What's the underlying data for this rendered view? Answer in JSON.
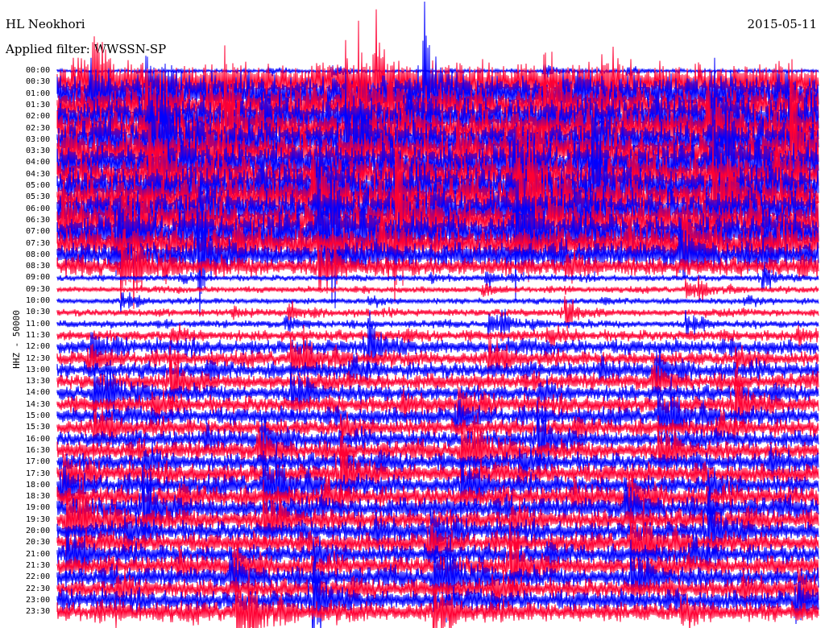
{
  "header": {
    "station": "HL Neokhori",
    "date": "2015-05-11",
    "filter": "Applied filter: WWSSN-SP"
  },
  "chart_data": {
    "type": "line",
    "title": "HL Neokhori",
    "subtitle": "Applied filter: WWSSN-SP",
    "date": "2015-05-11",
    "ylabel": "HHZ - 50000",
    "row_labels": [
      "00:00",
      "00:30",
      "01:00",
      "01:30",
      "02:00",
      "02:30",
      "03:00",
      "03:30",
      "04:00",
      "04:30",
      "05:00",
      "05:30",
      "06:00",
      "06:30",
      "07:00",
      "07:30",
      "08:00",
      "08:30",
      "09:00",
      "09:30",
      "10:00",
      "10:30",
      "11:00",
      "11:30",
      "12:00",
      "12:30",
      "13:00",
      "13:30",
      "14:00",
      "14:30",
      "15:00",
      "15:30",
      "16:00",
      "16:30",
      "17:00",
      "17:30",
      "18:00",
      "18:30",
      "19:00",
      "19:30",
      "20:00",
      "20:30",
      "21:00",
      "21:30",
      "22:00",
      "22:30",
      "23:00",
      "23:30"
    ],
    "row_colors": [
      "#0000ff",
      "#ff0033"
    ],
    "relative_activity": [
      0.3,
      3,
      3,
      3,
      3,
      3,
      3,
      3,
      3,
      3,
      3,
      3,
      3,
      3,
      3,
      2.6,
      2,
      1.5,
      0.5,
      0.5,
      0.5,
      0.6,
      0.6,
      0.9,
      1.2,
      1.2,
      1.3,
      1.3,
      1.3,
      1.4,
      1.4,
      1.4,
      1.4,
      1.5,
      1.5,
      1.6,
      1.6,
      1.7,
      1.7,
      1.7,
      1.6,
      1.6,
      1.6,
      1.6,
      1.6,
      1.6,
      1.6,
      1.6
    ]
  }
}
